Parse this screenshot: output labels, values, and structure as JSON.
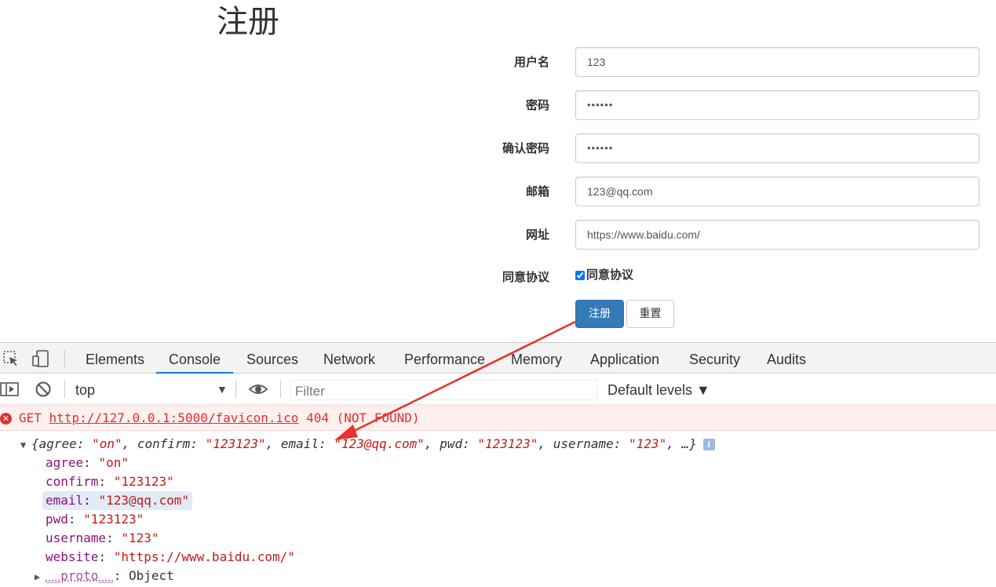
{
  "page": {
    "title": "注册",
    "fields": [
      {
        "label": "用户名",
        "value": "123"
      },
      {
        "label": "密码",
        "value": "••••••"
      },
      {
        "label": "确认密码",
        "value": "••••••"
      },
      {
        "label": "邮箱",
        "value": "123@qq.com"
      },
      {
        "label": "网址",
        "value": "https://www.baidu.com/"
      }
    ],
    "agree": {
      "label": "同意协议",
      "checkbox_label": "同意协议",
      "checked": true
    },
    "submit_label": "注册",
    "reset_label": "重置"
  },
  "devtools": {
    "tabs": [
      "Elements",
      "Console",
      "Sources",
      "Network",
      "Performance",
      "Memory",
      "Application",
      "Security",
      "Audits"
    ],
    "active_tab": "Console",
    "context": "top",
    "filter_placeholder": "Filter",
    "levels_label": "Default levels ▼",
    "error": {
      "method": "GET",
      "url": "http://127.0.0.1:5000/favicon.ico",
      "status": "404 (NOT FOUND)"
    },
    "object_summary": {
      "open": "{",
      "pairs": [
        {
          "k": "agree",
          "v": "\"on\""
        },
        {
          "k": "confirm",
          "v": "\"123123\""
        },
        {
          "k": "email",
          "v": "\"123@qq.com\""
        },
        {
          "k": "pwd",
          "v": "\"123123\""
        },
        {
          "k": "username",
          "v": "\"123\""
        }
      ],
      "tail": "…}"
    },
    "properties": [
      {
        "key": "agree",
        "value": "\"on\""
      },
      {
        "key": "confirm",
        "value": "\"123123\""
      },
      {
        "key": "email",
        "value": "\"123@qq.com\""
      },
      {
        "key": "pwd",
        "value": "\"123123\""
      },
      {
        "key": "username",
        "value": "\"123\""
      },
      {
        "key": "website",
        "value": "\"https://www.baidu.com/\""
      }
    ],
    "proto": {
      "key": "__proto__",
      "value": "Object"
    }
  },
  "colors": {
    "primary_button": "#337ab7",
    "tab_underline": "#1a73e8",
    "error_red": "#e0302b",
    "error_bg": "#fff0f0",
    "annotation_arrow": "#e8322b"
  }
}
